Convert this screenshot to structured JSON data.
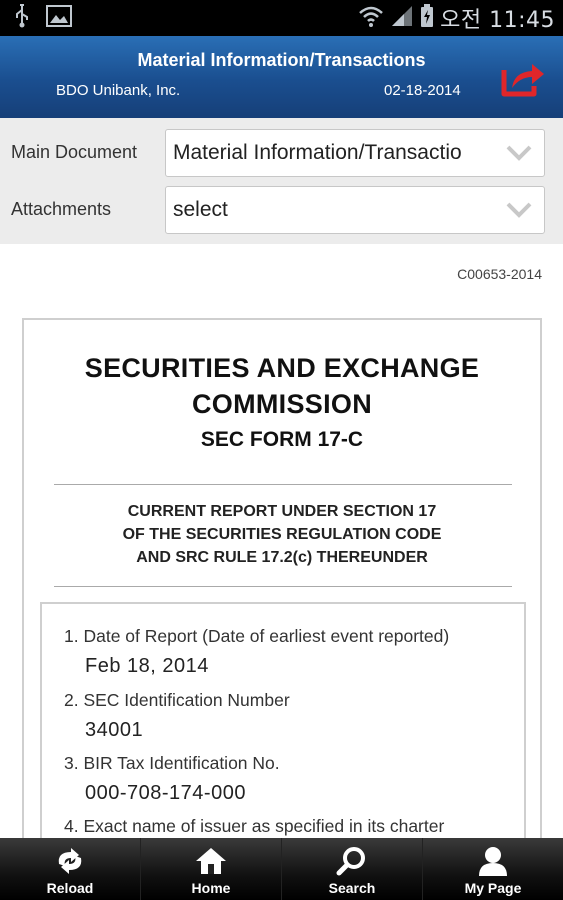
{
  "status_bar": {
    "icons": [
      "usb-icon",
      "image-icon",
      "wifi-icon",
      "signal-icon",
      "battery-charging-icon"
    ],
    "time": "오전 11:45"
  },
  "header": {
    "title": "Material Information/Transactions",
    "company": "BDO Unibank, Inc.",
    "date": "02-18-2014",
    "share_icon": "share-icon"
  },
  "filters": {
    "main_document_label": "Main Document",
    "main_document_value": "Material Information/Transactio",
    "attachments_label": "Attachments",
    "attachments_value": "select"
  },
  "document": {
    "id": "C00653-2014",
    "title_line1": "SECURITIES AND EXCHANGE",
    "title_line2": "COMMISSION",
    "form": "SEC FORM 17-C",
    "subtitle_line1": "CURRENT REPORT UNDER SECTION 17",
    "subtitle_line2": "OF THE SECURITIES REGULATION CODE",
    "subtitle_line3": "AND SRC RULE 17.2(c) THEREUNDER",
    "items": [
      {
        "label": "1. Date of Report (Date of earliest event reported)",
        "value": "Feb 18, 2014"
      },
      {
        "label": "2. SEC Identification Number",
        "value": "34001"
      },
      {
        "label": "3. BIR Tax Identification No.",
        "value": "000-708-174-000"
      },
      {
        "label": "4. Exact name of issuer as specified in its charter",
        "value": ""
      }
    ]
  },
  "nav": {
    "reload": "Reload",
    "home": "Home",
    "search": "Search",
    "mypage": "My Page"
  },
  "colors": {
    "header_blue": "#1a4e8f",
    "share_red": "#e0262a"
  }
}
